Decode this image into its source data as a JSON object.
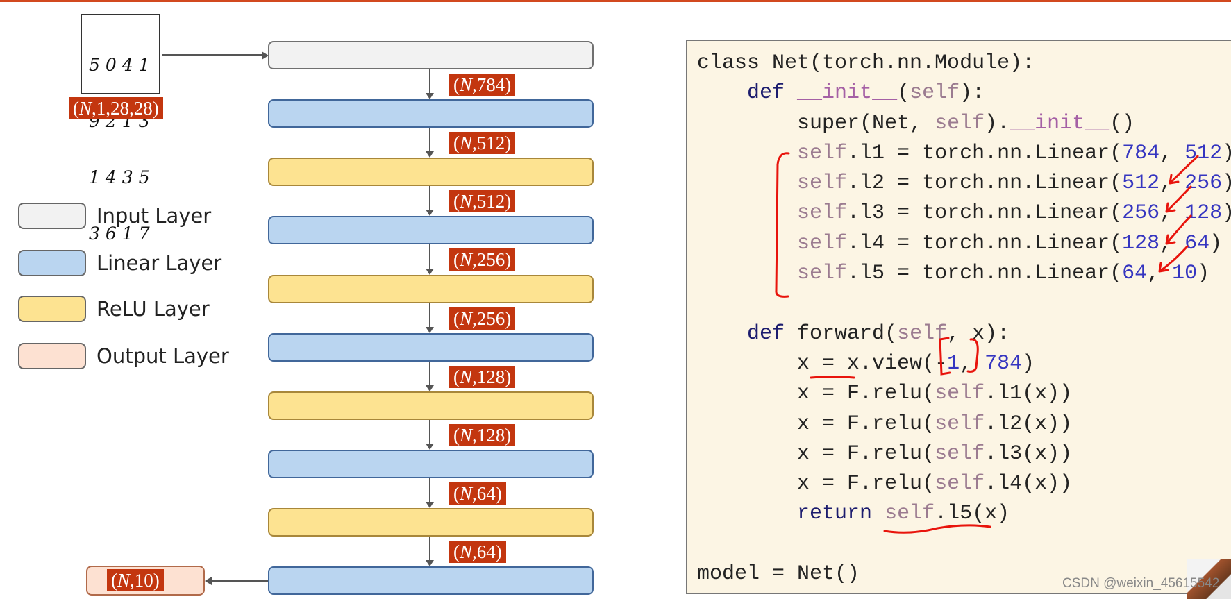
{
  "input_image": {
    "digits": [
      "5041",
      "9213",
      "1435",
      "3617"
    ],
    "shape": [
      "(",
      "N",
      ",1,28,28)"
    ]
  },
  "layers": [
    {
      "type": "input"
    },
    {
      "type": "linear"
    },
    {
      "type": "relu"
    },
    {
      "type": "linear"
    },
    {
      "type": "relu"
    },
    {
      "type": "linear"
    },
    {
      "type": "relu"
    },
    {
      "type": "linear"
    },
    {
      "type": "relu"
    },
    {
      "type": "linear"
    }
  ],
  "shapes": [
    [
      "(",
      "N",
      ",784)"
    ],
    [
      "(",
      "N",
      ",512)"
    ],
    [
      "(",
      "N",
      ",512)"
    ],
    [
      "(",
      "N",
      ",256)"
    ],
    [
      "(",
      "N",
      ",256)"
    ],
    [
      "(",
      "N",
      ",128)"
    ],
    [
      "(",
      "N",
      ",128)"
    ],
    [
      "(",
      "N",
      ",64)"
    ],
    [
      "(",
      "N",
      ",64)"
    ]
  ],
  "output_shape": [
    "(",
    "N",
    ",10)"
  ],
  "legend": [
    {
      "label": "Input Layer",
      "type": "input"
    },
    {
      "label": "Linear Layer",
      "type": "linear"
    },
    {
      "label": "ReLU Layer",
      "type": "relu"
    },
    {
      "label": "Output Layer",
      "type": "output"
    }
  ],
  "colors": {
    "input": "#f2f2f2",
    "linear": "#bad5f0",
    "relu": "#fde391",
    "output": "#fde1d2",
    "tag": "#c3360f",
    "annotation": "#e8140c"
  },
  "code": [
    [
      [
        "class",
        "plain"
      ],
      [
        " Net(torch.nn.Module):",
        "plain"
      ]
    ],
    [
      [
        "    ",
        "plain"
      ],
      [
        "def",
        "kw"
      ],
      [
        " ",
        "plain"
      ],
      [
        "__init__",
        "dunder"
      ],
      [
        "(",
        "plain"
      ],
      [
        "self",
        "self"
      ],
      [
        "):",
        "plain"
      ]
    ],
    [
      [
        "        super(Net, ",
        "plain"
      ],
      [
        "self",
        "self"
      ],
      [
        ").",
        "plain"
      ],
      [
        "__init__",
        "dunder"
      ],
      [
        "()",
        "plain"
      ]
    ],
    [
      [
        "        ",
        "plain"
      ],
      [
        "self",
        "self"
      ],
      [
        ".l1 = torch.nn.Linear(",
        "plain"
      ],
      [
        "784",
        "num"
      ],
      [
        ", ",
        "plain"
      ],
      [
        "512",
        "num"
      ],
      [
        ")",
        "plain"
      ]
    ],
    [
      [
        "        ",
        "plain"
      ],
      [
        "self",
        "self"
      ],
      [
        ".l2 = torch.nn.Linear(",
        "plain"
      ],
      [
        "512",
        "num"
      ],
      [
        ", ",
        "plain"
      ],
      [
        "256",
        "num"
      ],
      [
        ")",
        "plain"
      ]
    ],
    [
      [
        "        ",
        "plain"
      ],
      [
        "self",
        "self"
      ],
      [
        ".l3 = torch.nn.Linear(",
        "plain"
      ],
      [
        "256",
        "num"
      ],
      [
        ", ",
        "plain"
      ],
      [
        "128",
        "num"
      ],
      [
        ")",
        "plain"
      ]
    ],
    [
      [
        "        ",
        "plain"
      ],
      [
        "self",
        "self"
      ],
      [
        ".l4 = torch.nn.Linear(",
        "plain"
      ],
      [
        "128",
        "num"
      ],
      [
        ", ",
        "plain"
      ],
      [
        "64",
        "num"
      ],
      [
        ")",
        "plain"
      ]
    ],
    [
      [
        "        ",
        "plain"
      ],
      [
        "self",
        "self"
      ],
      [
        ".l5 = torch.nn.Linear(",
        "plain"
      ],
      [
        "64",
        "num"
      ],
      [
        ", ",
        "plain"
      ],
      [
        "10",
        "num"
      ],
      [
        ")",
        "plain"
      ]
    ],
    [],
    [
      [
        "    ",
        "plain"
      ],
      [
        "def",
        "kw"
      ],
      [
        " forward(",
        "plain"
      ],
      [
        "self",
        "self"
      ],
      [
        ", x):",
        "plain"
      ]
    ],
    [
      [
        "        x = x.view(-",
        "plain"
      ],
      [
        "1",
        "num"
      ],
      [
        ", ",
        "plain"
      ],
      [
        "784",
        "num"
      ],
      [
        ")",
        "plain"
      ]
    ],
    [
      [
        "        x = F.relu(",
        "plain"
      ],
      [
        "self",
        "self"
      ],
      [
        ".l1(x))",
        "plain"
      ]
    ],
    [
      [
        "        x = F.relu(",
        "plain"
      ],
      [
        "self",
        "self"
      ],
      [
        ".l2(x))",
        "plain"
      ]
    ],
    [
      [
        "        x = F.relu(",
        "plain"
      ],
      [
        "self",
        "self"
      ],
      [
        ".l3(x))",
        "plain"
      ]
    ],
    [
      [
        "        x = F.relu(",
        "plain"
      ],
      [
        "self",
        "self"
      ],
      [
        ".l4(x))",
        "plain"
      ]
    ],
    [
      [
        "        ",
        "plain"
      ],
      [
        "return",
        "kw"
      ],
      [
        " ",
        "plain"
      ],
      [
        "self",
        "self"
      ],
      [
        ".l5(x)",
        "plain"
      ]
    ],
    [],
    [
      [
        "model = Net()",
        "plain"
      ]
    ]
  ],
  "watermark": "CSDN @weixin_45615542"
}
